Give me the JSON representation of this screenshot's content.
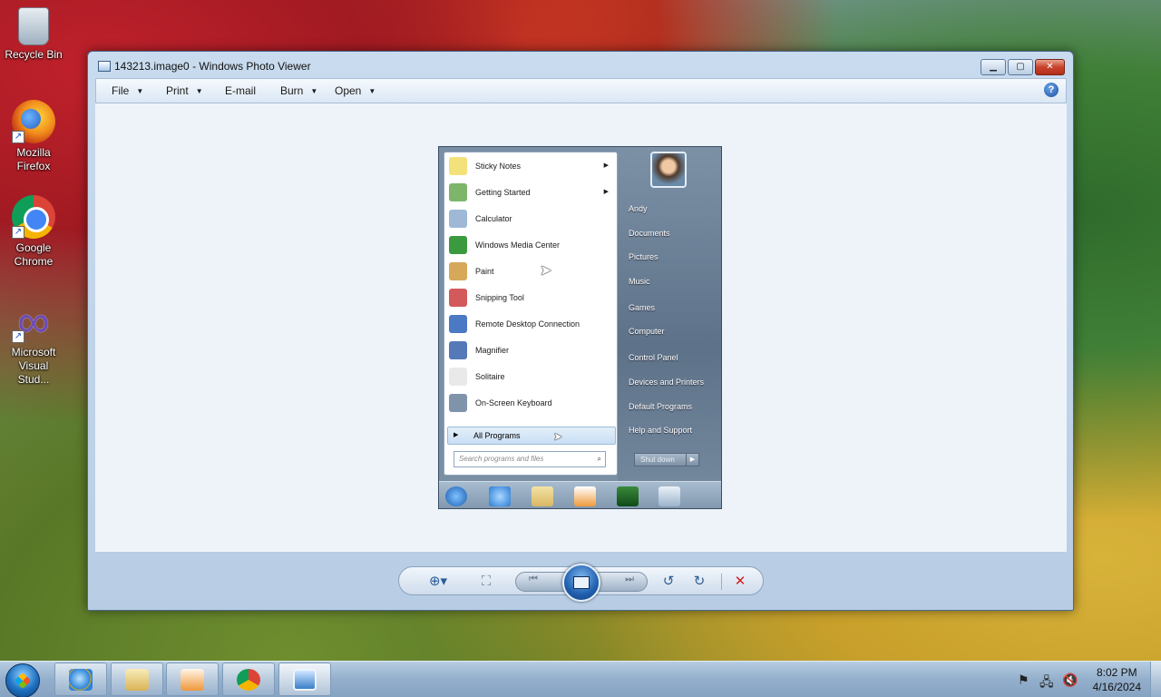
{
  "desktop": {
    "icons": [
      {
        "label": "Recycle Bin"
      },
      {
        "label": "Mozilla Firefox"
      },
      {
        "label": "Google Chrome"
      },
      {
        "label": "Microsoft Visual Stud..."
      }
    ]
  },
  "window": {
    "title": "143213.image0 - Windows Photo Viewer",
    "controls": {
      "minimize": "▁",
      "maximize": "▢",
      "close": "✕"
    },
    "menu": {
      "file": "File",
      "print": "Print",
      "email": "E-mail",
      "burn": "Burn",
      "open": "Open",
      "dropdown_arrow": "▼",
      "help": "?"
    }
  },
  "photo": {
    "start_menu": {
      "programs": [
        {
          "label": "Sticky Notes",
          "has_submenu": true,
          "color": "#f3e27a"
        },
        {
          "label": "Getting Started",
          "has_submenu": true,
          "color": "#7db66b"
        },
        {
          "label": "Calculator",
          "has_submenu": false,
          "color": "#9eb8d6"
        },
        {
          "label": "Windows Media Center",
          "has_submenu": false,
          "color": "#3c9a3e"
        },
        {
          "label": "Paint",
          "has_submenu": false,
          "color": "#d6a85a"
        },
        {
          "label": "Snipping Tool",
          "has_submenu": false,
          "color": "#d25a5a"
        },
        {
          "label": "Remote Desktop Connection",
          "has_submenu": false,
          "color": "#4b79c4"
        },
        {
          "label": "Magnifier",
          "has_submenu": false,
          "color": "#5579b8"
        },
        {
          "label": "Solitaire",
          "has_submenu": false,
          "color": "#e9e9e9"
        },
        {
          "label": "On-Screen Keyboard",
          "has_submenu": false,
          "color": "#7f93ab"
        }
      ],
      "submenu_arrow": "▶",
      "all_programs": "All Programs",
      "search_placeholder": "Search programs and files",
      "search_icon": "⌕",
      "right_links": [
        "Andy",
        "Documents",
        "Pictures",
        "Music",
        "Games",
        "Computer",
        "Control Panel",
        "Devices and Printers",
        "Default Programs",
        "Help and Support"
      ],
      "shutdown": "Shut down",
      "shutdown_arrow": "▶"
    }
  },
  "viewer_controls": {
    "zoom": "⊕▾",
    "actual_size": "⛶",
    "previous": "⏮",
    "next": "⏭",
    "rotate_ccw": "↺",
    "rotate_cw": "↻",
    "delete": "✕"
  },
  "taskbar": {
    "clock": {
      "time": "8:02 PM",
      "date": "4/16/2024"
    },
    "tray": {
      "flag": "⚑",
      "network": "🖧",
      "volume": "🔇"
    }
  },
  "colors": {
    "delete": "#d32020",
    "accent": "#2d5d97"
  }
}
